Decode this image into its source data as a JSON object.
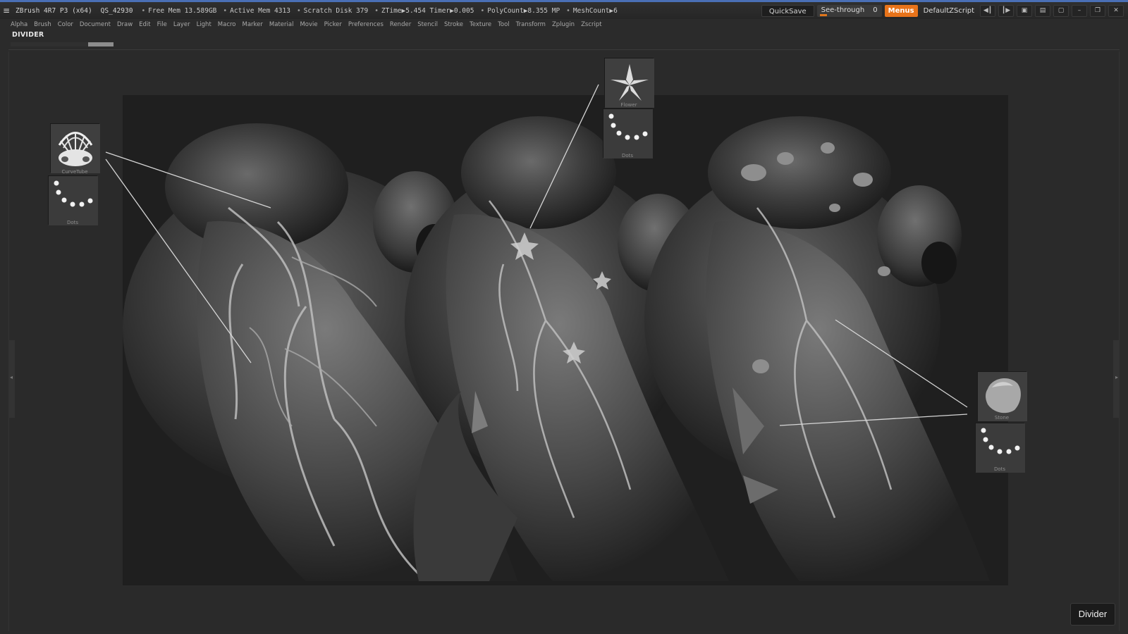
{
  "titlebar": {
    "app_title": "ZBrush 4R7 P3 (x64)",
    "quicksave_id": "QS_42930",
    "stats": [
      "Free Mem 13.589GB",
      "Active Mem 4313",
      "Scratch Disk 379",
      "ZTime▶5.454 Timer▶0.005",
      "PolyCount▶8.355 MP",
      "MeshCount▶6"
    ],
    "quicksave_label": "QuickSave",
    "seethrough_label": "See-through",
    "seethrough_value": "0",
    "menus_label": "Menus",
    "script_label": "DefaultZScript"
  },
  "menubar": {
    "items": [
      "Alpha",
      "Brush",
      "Color",
      "Document",
      "Draw",
      "Edit",
      "File",
      "Layer",
      "Light",
      "Macro",
      "Marker",
      "Material",
      "Movie",
      "Picker",
      "Preferences",
      "Render",
      "Stencil",
      "Stroke",
      "Texture",
      "Tool",
      "Transform",
      "Zplugin",
      "Zscript"
    ]
  },
  "palette": {
    "title": "DIVIDER"
  },
  "thumbnails": {
    "curvetube": "CurveTube",
    "dots": "Dots",
    "flower": "Flower",
    "stone": "Stone"
  },
  "badge": {
    "label": "Divider"
  },
  "colors": {
    "accent_orange": "#e8731a",
    "title_blue": "#4a6fb5",
    "ui_dark": "#2b2b2b"
  }
}
